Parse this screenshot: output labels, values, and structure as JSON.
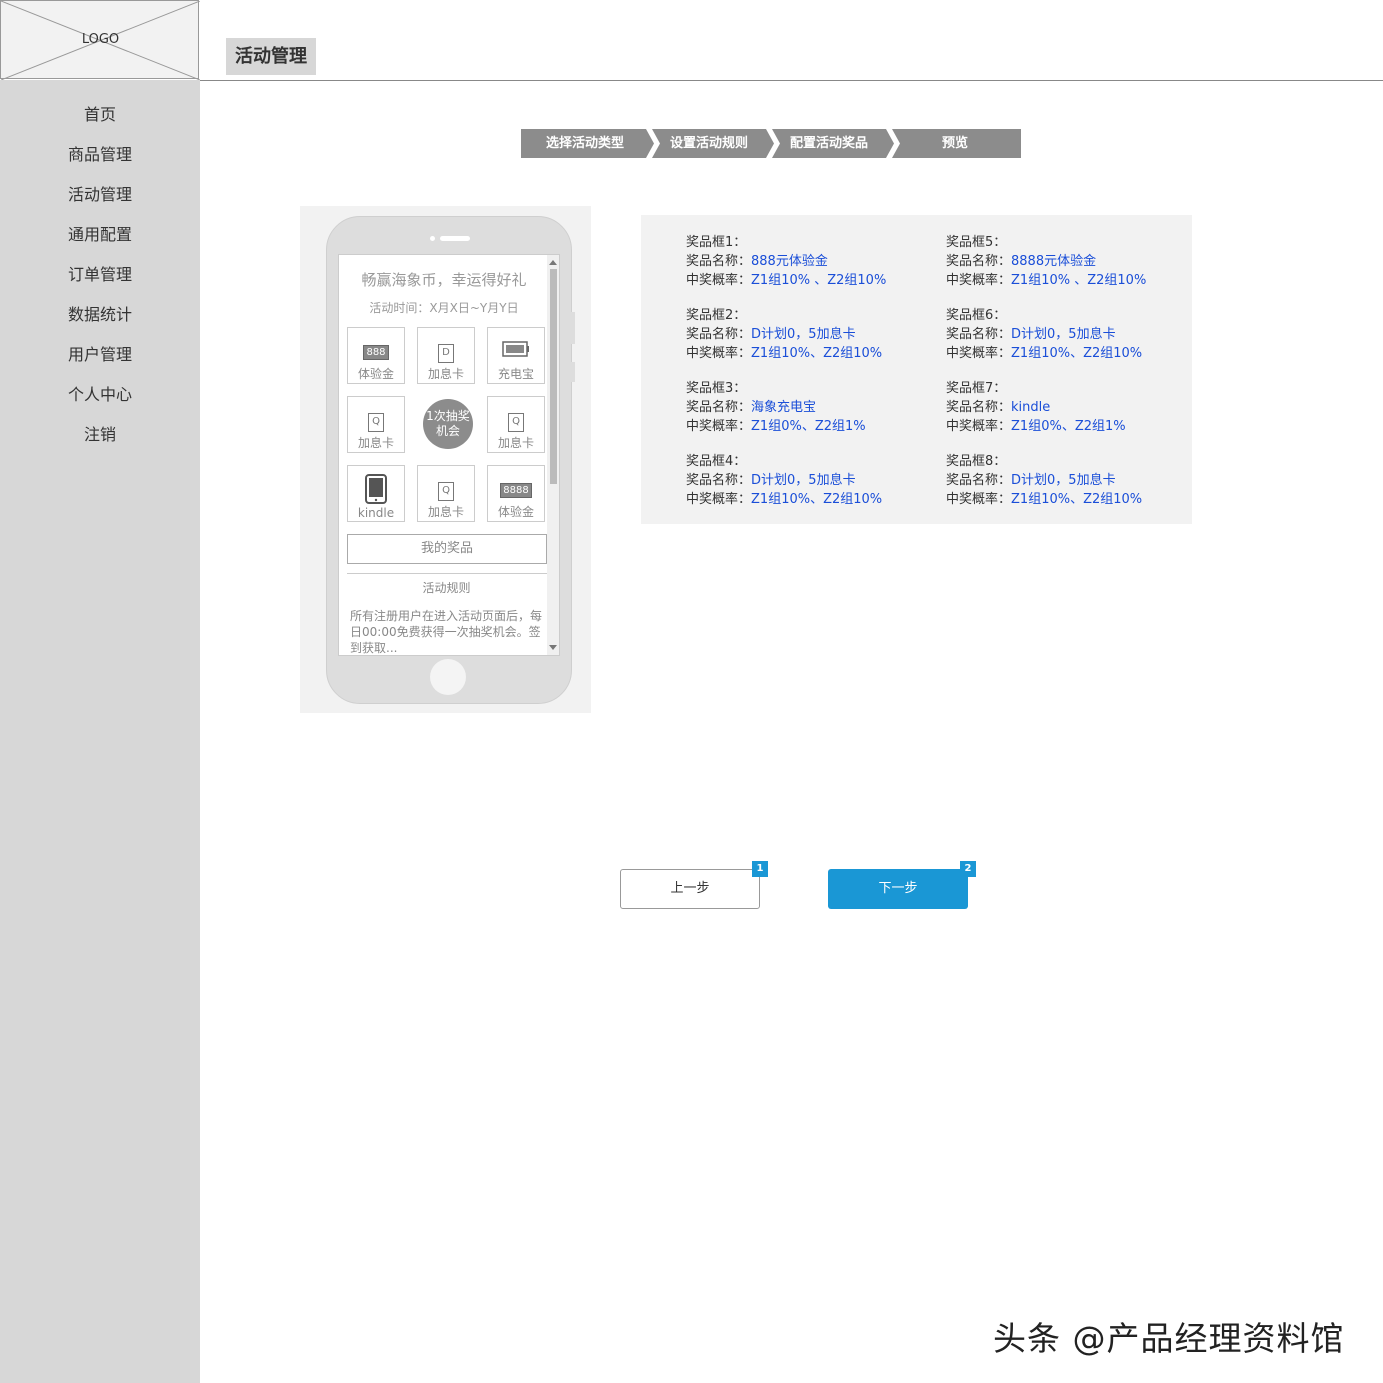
{
  "header": {
    "logo_text": "LOGO",
    "page_title": "活动管理"
  },
  "sidebar": {
    "items": [
      "首页",
      "商品管理",
      "活动管理",
      "通用配置",
      "订单管理",
      "数据统计",
      "用户管理",
      "个人中心",
      "注销"
    ]
  },
  "steps": [
    "选择活动类型",
    "设置活动规则",
    "配置活动奖品",
    "预览"
  ],
  "phone": {
    "title": "畅赢海象币，幸运得好礼",
    "time": "活动时间：X月X日~Y月Y日",
    "grid": [
      {
        "label": "体验金",
        "icon": "888"
      },
      {
        "label": "加息卡",
        "icon": "D"
      },
      {
        "label": "充电宝",
        "icon": "battery-icon"
      },
      {
        "label": "加息卡",
        "icon": "Q"
      },
      {
        "label": "1次抽奖机会",
        "icon": "draw-button"
      },
      {
        "label": "加息卡",
        "icon": "Q"
      },
      {
        "label": "kindle",
        "icon": "tablet-icon"
      },
      {
        "label": "加息卡",
        "icon": "Q"
      },
      {
        "label": "体验金",
        "icon": "8888"
      }
    ],
    "draw_button": [
      "1次抽奖",
      "机会"
    ],
    "my_prize": "我的奖品",
    "rules_title": "活动规则",
    "rules_text": "所有注册用户在进入活动页面后，每日00:00免费获得一次抽奖机会。签到获取..."
  },
  "prizes": [
    {
      "box": "奖品框1：",
      "name_label": "奖品名称：",
      "name": "888元体验金",
      "rate_label": "中奖概率：",
      "rate": "Z1组10% 、Z2组10%"
    },
    {
      "box": "奖品框2：",
      "name_label": "奖品名称：",
      "name": "D计划0，5加息卡",
      "rate_label": "中奖概率：",
      "rate": "Z1组10%、Z2组10%"
    },
    {
      "box": "奖品框3：",
      "name_label": "奖品名称：",
      "name": "海象充电宝",
      "rate_label": "中奖概率：",
      "rate": "Z1组0%、Z2组1%"
    },
    {
      "box": "奖品框4：",
      "name_label": "奖品名称：",
      "name": "D计划0，5加息卡",
      "rate_label": "中奖概率：",
      "rate": "Z1组10%、Z2组10%"
    },
    {
      "box": "奖品框5：",
      "name_label": "奖品名称：",
      "name": "8888元体验金",
      "rate_label": "中奖概率：",
      "rate": "Z1组10% 、Z2组10%"
    },
    {
      "box": "奖品框6：",
      "name_label": "奖品名称：",
      "name": "D计划0，5加息卡",
      "rate_label": "中奖概率：",
      "rate": "Z1组10%、Z2组10%"
    },
    {
      "box": "奖品框7：",
      "name_label": "奖品名称：",
      "name": "kindle",
      "rate_label": "中奖概率：",
      "rate": "Z1组0%、Z2组1%"
    },
    {
      "box": "奖品框8：",
      "name_label": "奖品名称：",
      "name": "D计划0，5加息卡",
      "rate_label": "中奖概率：",
      "rate": "Z1组10%、Z2组10%"
    }
  ],
  "buttons": {
    "prev": "上一步",
    "prev_badge": "1",
    "next": "下一步",
    "next_badge": "2"
  },
  "watermark": "头条 @产品经理资料馆",
  "colors": {
    "sidebar_bg": "#d7d7d7",
    "step_bg": "#8c8c8c",
    "primary": "#1a97d5",
    "link_blue": "#1a4ed8"
  }
}
